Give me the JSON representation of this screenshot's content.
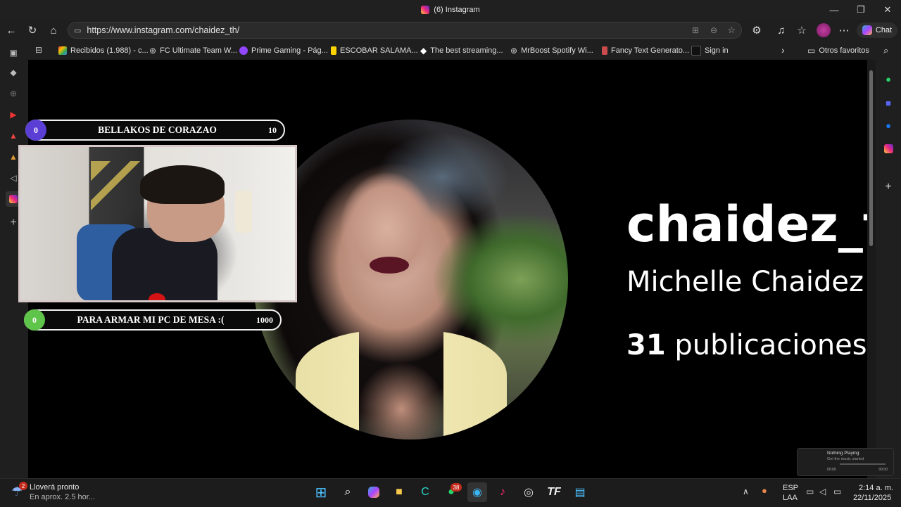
{
  "window": {
    "title": "(6) Instagram",
    "controls": [
      "—",
      "❐",
      "✕"
    ]
  },
  "nav": {
    "url": "https://www.instagram.com/chaidez_th/",
    "chat_label": "Chat"
  },
  "bookmarks": [
    {
      "label": "Recibidos (1.988) - c...",
      "icon": "gmail-icon"
    },
    {
      "label": "FC Ultimate Team W...",
      "icon": "globe-icon"
    },
    {
      "label": "Prime Gaming - Pág...",
      "icon": "prime-gaming-icon"
    },
    {
      "label": "ESCOBAR SALAMA...",
      "icon": "bookmark-icon"
    },
    {
      "label": "The best streaming...",
      "icon": "streaming-icon"
    },
    {
      "label": "MrBoost Spotify Wi...",
      "icon": "globe-icon"
    },
    {
      "label": "Fancy Text Generato...",
      "icon": "text-generator-icon"
    },
    {
      "label": "Sign in",
      "icon": "sign-in-icon"
    },
    {
      "label": "Otros favoritos",
      "icon": "folder-icon"
    }
  ],
  "profile": {
    "username": "chaidez_th",
    "full_name": "Michelle Chaidez",
    "posts_count": "31",
    "posts_label": "publicaciones"
  },
  "overlay": {
    "goal1": {
      "current": "0",
      "label": "BELLAKOS DE CORAZAO",
      "target": "10",
      "color": "#5b3fd4"
    },
    "goal2": {
      "current": "0",
      "label": "PARA ARMAR MI PC DE MESA :(",
      "target": "1000",
      "color": "#5fc44a"
    }
  },
  "now_playing": {
    "title": "Nothing Playing",
    "subtitle": "Get the music started",
    "time_start": "00:00",
    "time_end": "00:00"
  },
  "taskbar": {
    "weather_badge": "2",
    "weather_title": "Lloverá pronto",
    "weather_sub": "En aprox. 2.5 hor...",
    "whatsapp_badge": "38",
    "lang_top": "ESP",
    "lang_bottom": "LAA",
    "time": "2:14 a. m.",
    "date": "22/11/2025"
  }
}
